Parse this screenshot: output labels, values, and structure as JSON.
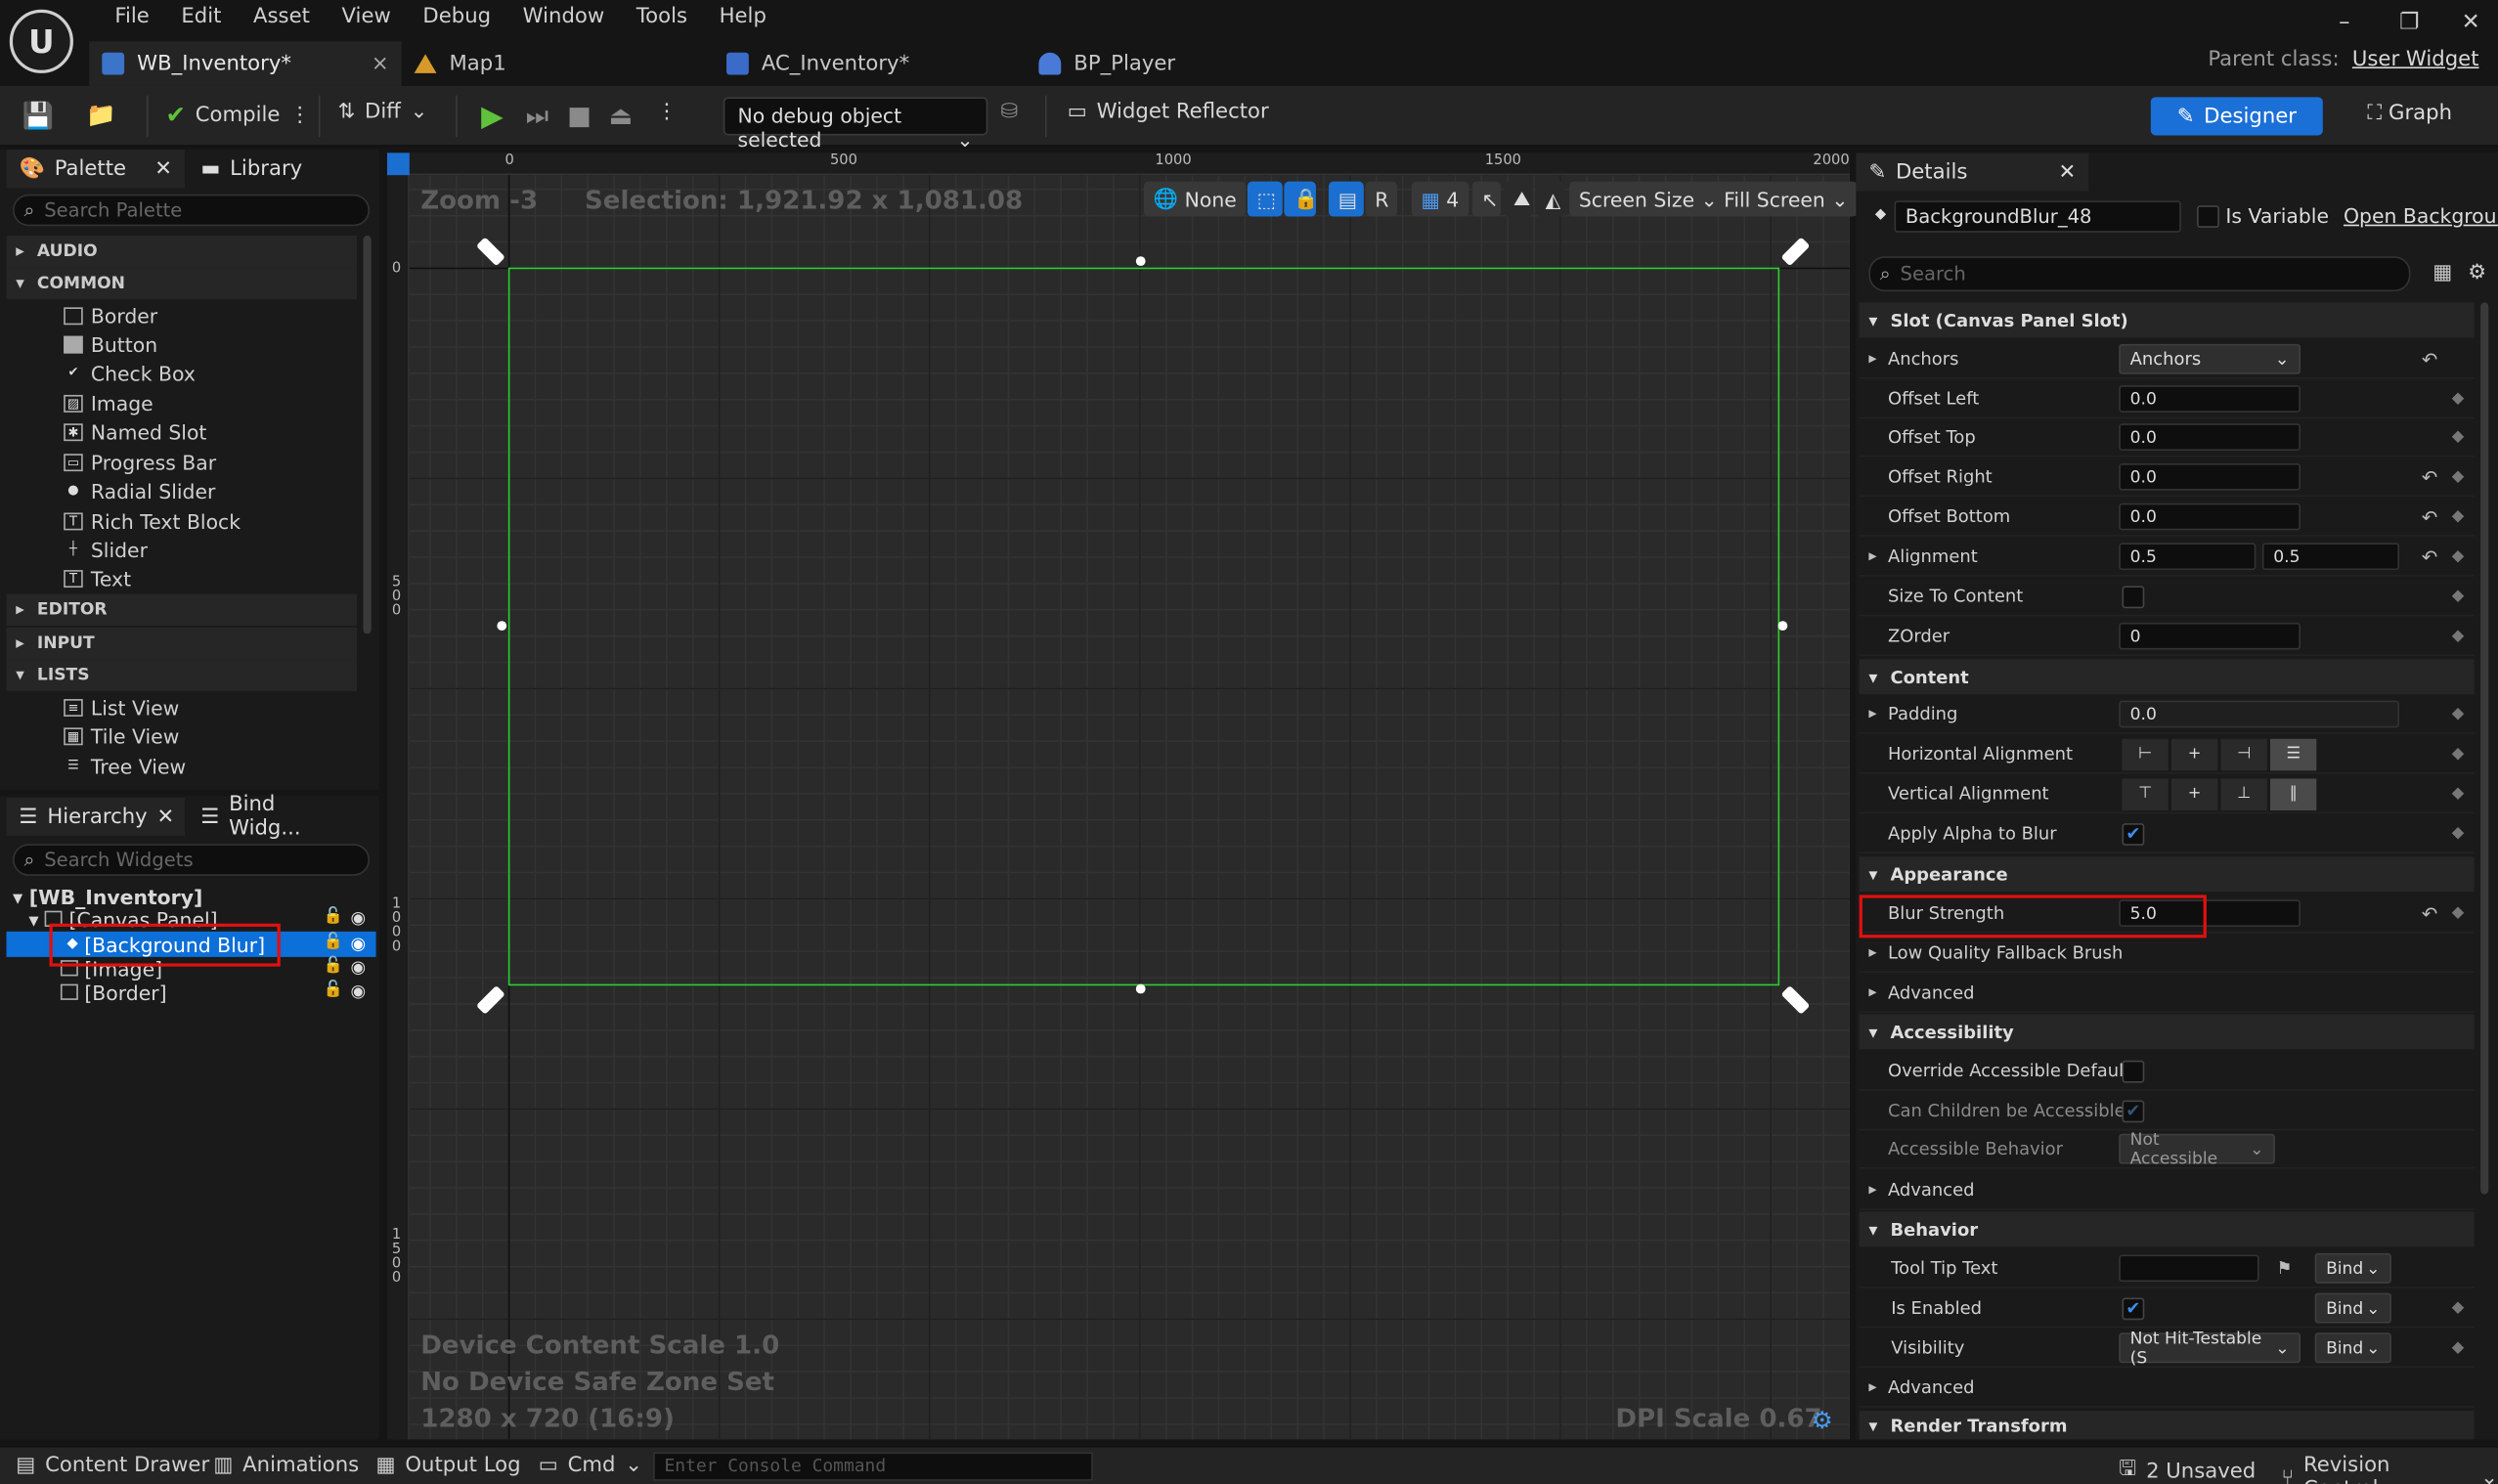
{
  "app": {
    "logo": "U",
    "menu": [
      "File",
      "Edit",
      "Asset",
      "View",
      "Debug",
      "Window",
      "Tools",
      "Help"
    ],
    "tabs": [
      {
        "label": "WB_Inventory*",
        "icon": "widget-blueprint-icon",
        "close": "×"
      },
      {
        "label": "Map1",
        "icon": "level-icon"
      },
      {
        "label": "AC_Inventory*",
        "icon": "component-icon"
      },
      {
        "label": "BP_Player",
        "icon": "pawn-icon"
      }
    ],
    "parent_label": "Parent class:",
    "parent_value": "User Widget",
    "window": {
      "min": "–",
      "restore": "❐",
      "close": "✕"
    }
  },
  "toolbar": {
    "compile": "Compile",
    "diff": "Diff",
    "debug_object": "No debug object selected",
    "widget_reflector": "Widget Reflector",
    "designer": "Designer",
    "graph": "Graph"
  },
  "palette": {
    "tab": "Palette",
    "library_tab": "Library",
    "search_placeholder": "Search Palette",
    "categories": [
      "AUDIO",
      "COMMON",
      "EDITOR",
      "INPUT",
      "LISTS"
    ],
    "common_items": [
      "Border",
      "Button",
      "Check Box",
      "Image",
      "Named Slot",
      "Progress Bar",
      "Radial Slider",
      "Rich Text Block",
      "Slider",
      "Text"
    ],
    "list_items": [
      "List View",
      "Tile View",
      "Tree View"
    ]
  },
  "hierarchy": {
    "tab": "Hierarchy",
    "bind_tab": "Bind Widg...",
    "search_placeholder": "Search Widgets",
    "root": "[WB_Inventory]",
    "canvas": "[Canvas Panel]",
    "selected": "[Background Blur]",
    "image": "[Image]",
    "border": "[Border]"
  },
  "canvas": {
    "zoom": "Zoom -3",
    "selection": "Selection: 1,921.92 x 1,081.08",
    "ruler_h": [
      "0",
      "500",
      "1000",
      "1500",
      "2000"
    ],
    "ruler_v": [
      "0",
      "500",
      "1000",
      "1500"
    ],
    "none_btn": "None",
    "r_btn": "R",
    "grid_num": "4",
    "screen_size": "Screen Size",
    "fill_screen": "Fill Screen",
    "device_scale": "Device Content Scale 1.0",
    "safe_zone": "No Device Safe Zone Set",
    "resolution": "1280 x 720 (16:9)",
    "dpi": "DPI Scale 0.67"
  },
  "details": {
    "tab": "Details",
    "widget_name": "BackgroundBlur_48",
    "is_variable": "Is Variable",
    "open_link": "Open Background",
    "search_placeholder": "Search",
    "slot_section": "Slot (Canvas Panel Slot)",
    "anchors_label": "Anchors",
    "anchors_value": "Anchors",
    "offset_left_label": "Offset Left",
    "offset_left": "0.0",
    "offset_top_label": "Offset Top",
    "offset_top": "0.0",
    "offset_right_label": "Offset Right",
    "offset_right": "0.0",
    "offset_bottom_label": "Offset Bottom",
    "offset_bottom": "0.0",
    "alignment_label": "Alignment",
    "alignment_x": "0.5",
    "alignment_y": "0.5",
    "size_to_content_label": "Size To Content",
    "zorder_label": "ZOrder",
    "zorder": "0",
    "content_section": "Content",
    "padding_label": "Padding",
    "padding": "0.0",
    "h_align_label": "Horizontal Alignment",
    "v_align_label": "Vertical Alignment",
    "apply_alpha_label": "Apply Alpha to Blur",
    "appearance_section": "Appearance",
    "blur_strength_label": "Blur Strength",
    "blur_strength": "5.0",
    "low_quality_label": "Low Quality Fallback Brush",
    "advanced_label": "Advanced",
    "accessibility_section": "Accessibility",
    "override_access_label": "Override Accessible Defaults",
    "children_access_label": "Can Children be Accessible",
    "access_behavior_label": "Accessible Behavior",
    "access_behavior": "Not Accessible",
    "advanced2_label": "Advanced",
    "behavior_section": "Behavior",
    "tooltip_label": "Tool Tip Text",
    "bind": "Bind",
    "enabled_label": "Is Enabled",
    "visibility_label": "Visibility",
    "visibility": "Not Hit-Testable (S",
    "advanced3_label": "Advanced",
    "render_section": "Render Transform"
  },
  "status": {
    "content_drawer": "Content Drawer",
    "animations": "Animations",
    "output_log": "Output Log",
    "cmd": "Cmd",
    "console_placeholder": "Enter Console Command",
    "unsaved": "2 Unsaved",
    "revision": "Revision Control"
  }
}
